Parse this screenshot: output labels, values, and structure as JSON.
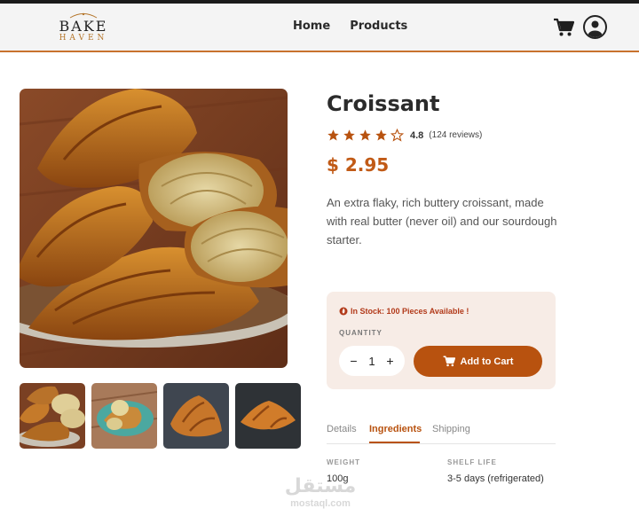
{
  "brand": {
    "name": "BAKE",
    "tagline": "HAVEN"
  },
  "nav": {
    "items": [
      {
        "label": "Home"
      },
      {
        "label": "Products"
      }
    ]
  },
  "product": {
    "title": "Croissant",
    "rating": 4.8,
    "rating_text": "4.8",
    "stars_filled": 4,
    "stars_total": 5,
    "reviews": "(124 reviews)",
    "price": "$ 2.95",
    "description": "An extra flaky, rich buttery croissant, made with real butter (never oil) and our sourdough starter."
  },
  "purchase": {
    "stock_text": "In Stock: 100 Pieces Available !",
    "quantity_label": "QUANTITY",
    "minus": "−",
    "quantity": "1",
    "plus": "+",
    "add_label": "Add to Cart"
  },
  "tabs": [
    {
      "label": "Details"
    },
    {
      "label": "Ingredients"
    },
    {
      "label": "Shipping"
    }
  ],
  "active_tab": "Ingredients",
  "specs": [
    {
      "label": "WEIGHT",
      "value": "100g"
    },
    {
      "label": "SHELF LIFE",
      "value": "3-5 days (refrigerated)"
    }
  ],
  "watermark": {
    "arabic": "مستقل",
    "latin": "mostaql.com"
  },
  "colors": {
    "accent": "#b8520f",
    "price": "#c15a16",
    "stock": "#b23a1a",
    "stock_bg": "#f7ece6",
    "header_line": "#c8722e"
  },
  "icons": [
    "cart-icon",
    "user-icon",
    "star-icon",
    "fire-icon",
    "minus-icon",
    "plus-icon"
  ]
}
